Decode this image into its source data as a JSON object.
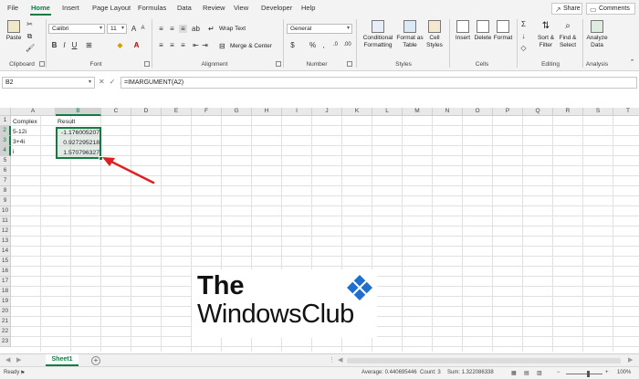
{
  "menu": {
    "tabs": [
      "File",
      "Home",
      "Insert",
      "Page Layout",
      "Formulas",
      "Data",
      "Review",
      "View",
      "Developer",
      "Help"
    ],
    "active": "Home",
    "share": "Share",
    "comments": "Comments"
  },
  "ribbon": {
    "clipboard": {
      "paste": "Paste",
      "label": "Clipboard"
    },
    "font": {
      "name": "Calibri",
      "size": "11",
      "label": "Font"
    },
    "alignment": {
      "wrap_text": "Wrap Text",
      "merge_center": "Merge & Center",
      "label": "Alignment"
    },
    "number": {
      "format": "General",
      "label": "Number"
    },
    "styles": {
      "conditional_formatting": "Conditional Formatting",
      "format_as_table": "Format as Table",
      "cell_styles": "Cell Styles",
      "label": "Styles"
    },
    "cells": {
      "insert": "Insert",
      "delete": "Delete",
      "format": "Format",
      "label": "Cells"
    },
    "editing": {
      "sort_filter": "Sort & Filter",
      "find_select": "Find & Select",
      "label": "Editing"
    },
    "analysis": {
      "analyze_data": "Analyze Data",
      "label": "Analysis"
    }
  },
  "formula_bar": {
    "name_box": "B2",
    "formula": "=IMARGUMENT(A2)"
  },
  "grid": {
    "columns": [
      "A",
      "B",
      "C",
      "D",
      "E",
      "F",
      "G",
      "H",
      "I",
      "J",
      "K",
      "L",
      "M",
      "N",
      "O",
      "P",
      "Q",
      "R",
      "S",
      "T"
    ],
    "rows": [
      "1",
      "2",
      "3",
      "4",
      "5",
      "6",
      "7",
      "8",
      "9",
      "10",
      "11",
      "12",
      "13",
      "14",
      "15",
      "16",
      "17",
      "18",
      "19",
      "20",
      "21",
      "22",
      "23"
    ],
    "cells": {
      "a1": "Complex",
      "b1": "Result",
      "a2": "5-12i",
      "b2": "-1.176005207",
      "a3": "3+4i",
      "b3": "0.927295218",
      "a4": "i",
      "b4": "1.570796327"
    }
  },
  "watermark": {
    "line1": "The",
    "line2": "WindowsClub"
  },
  "sheets": {
    "active": "Sheet1"
  },
  "status": {
    "mode": "Ready",
    "average": "Average: 0.440695446",
    "count": "Count: 3",
    "sum": "Sum: 1.322086338",
    "zoom": "100%"
  },
  "colors": {
    "accent": "#107c41",
    "arrow": "#e02020"
  }
}
